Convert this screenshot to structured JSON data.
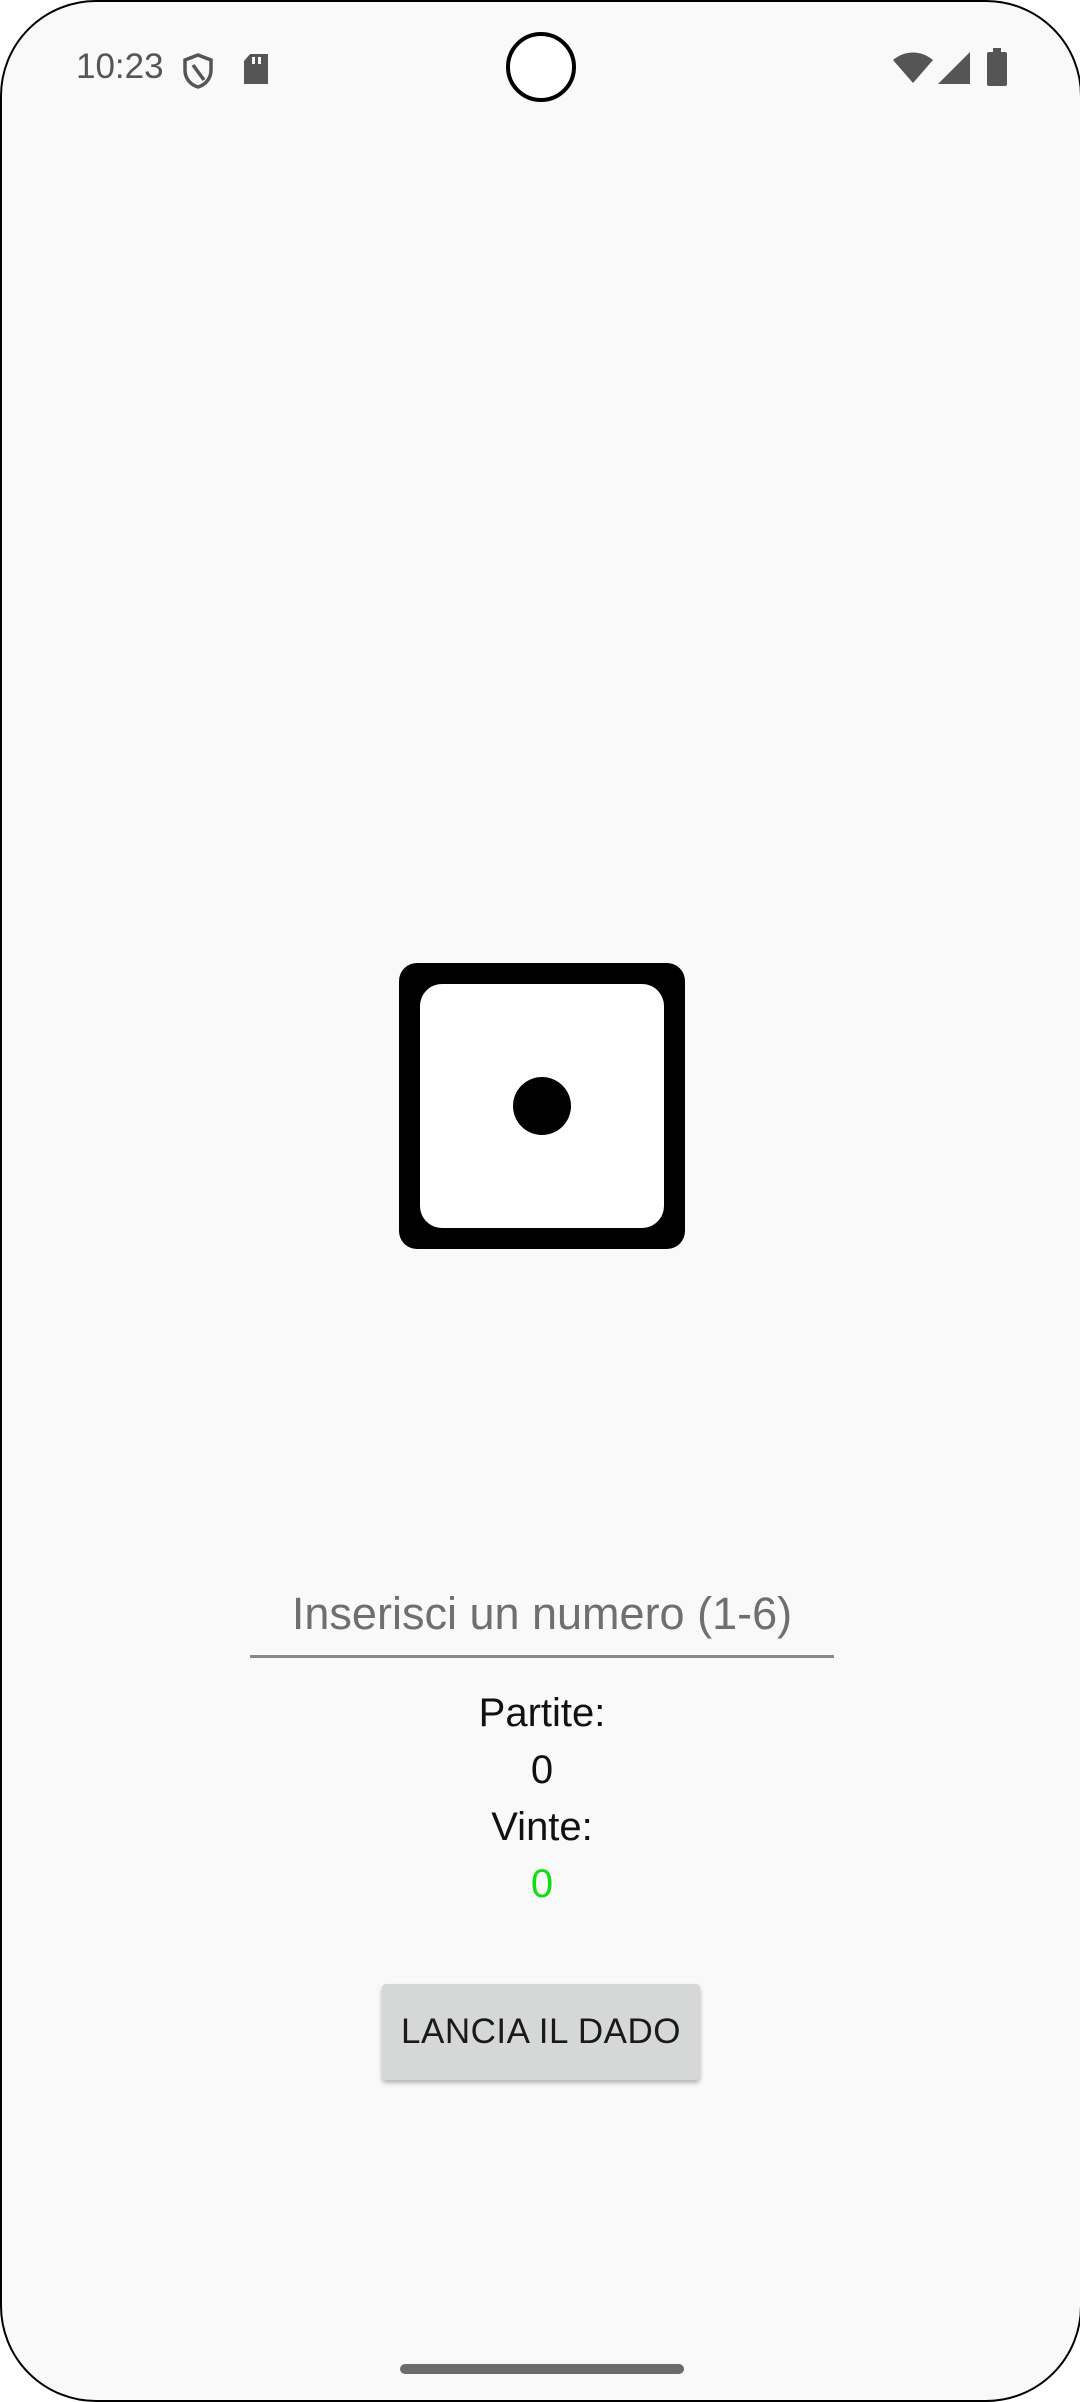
{
  "status_bar": {
    "time": "10:23",
    "left_icons": [
      "shield-icon",
      "sd-card-icon"
    ],
    "right_icons": [
      "wifi-icon",
      "signal-icon",
      "battery-icon"
    ]
  },
  "dice": {
    "value": 1,
    "icon": "dice-one-icon"
  },
  "number_input": {
    "placeholder": "Inserisci un numero (1-6)",
    "value": ""
  },
  "stats": {
    "games_label": "Partite:",
    "games_value": "0",
    "wins_label": "Vinte:",
    "wins_value": "0",
    "wins_color": "#11dd11"
  },
  "roll_button": {
    "label": "LANCIA IL DADO"
  },
  "colors": {
    "background": "#f9f9f9",
    "button": "#d6d7d7"
  }
}
